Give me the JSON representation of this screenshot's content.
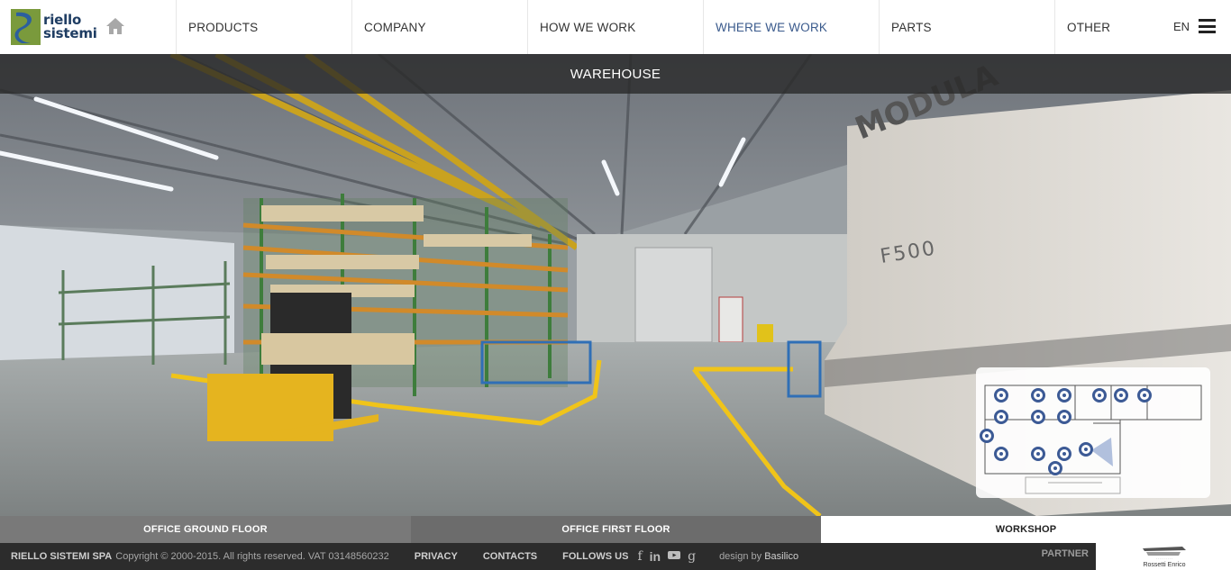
{
  "header": {
    "logo_line1": "riello",
    "logo_line2": "sistemi",
    "nav": [
      {
        "label": "PRODUCTS"
      },
      {
        "label": "COMPANY"
      },
      {
        "label": "HOW WE WORK"
      },
      {
        "label": "WHERE WE WORK"
      },
      {
        "label": "PARTS"
      },
      {
        "label": "OTHER"
      }
    ],
    "active_nav": "WHERE WE WORK",
    "language": "EN"
  },
  "panorama": {
    "title": "WAREHOUSE",
    "scene_labels": {
      "machine_brand": "MODULA",
      "machine_model": "F500"
    }
  },
  "floorplan": {
    "hotspot_count": 16
  },
  "tabs": [
    {
      "label": "OFFICE GROUND FLOOR",
      "selected": false
    },
    {
      "label": "OFFICE FIRST FLOOR",
      "selected": false
    },
    {
      "label": "WORKSHOP",
      "selected": true
    }
  ],
  "footer": {
    "company": "RIELLO SISTEMI SPA",
    "copyright": "Copyright © 2000-2015. All rights reserved. VAT 03148560232",
    "links": [
      "PRIVACY",
      "CONTACTS"
    ],
    "follow_label": "FOLLOWS US",
    "social": [
      "facebook-icon",
      "linkedin-icon",
      "youtube-icon",
      "google-plus-icon"
    ],
    "design_prefix": "design by",
    "design_by": "Basilico",
    "partner_label": "PARTNER",
    "partner_name": "Rossetti Enrico"
  },
  "colors": {
    "accent": "#3a5a8c",
    "footer_bg": "#2c2c2c",
    "hotspot": "#3c5a95",
    "title_bar": "#282828",
    "floor_line": "#f0c419"
  }
}
